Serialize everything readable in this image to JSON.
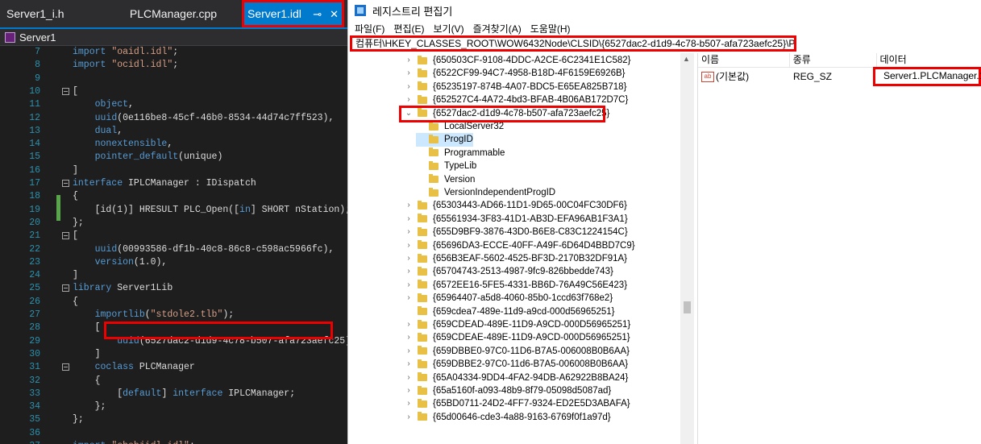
{
  "editor": {
    "tabs": [
      {
        "label": "Server1_i.h"
      },
      {
        "label": "PLCManager.cpp"
      },
      {
        "label": "Server1.idl",
        "pin": "⊸",
        "close": "✕"
      }
    ],
    "object_label": "Server1",
    "lines": [
      {
        "n": "7",
        "text": "import \"oaidl.idl\";"
      },
      {
        "n": "8",
        "text": "import \"ocidl.idl\";"
      },
      {
        "n": "9",
        "text": ""
      },
      {
        "n": "10",
        "text": "["
      },
      {
        "n": "11",
        "text": "    object,"
      },
      {
        "n": "12",
        "text": "    uuid(0e116be8-45cf-46b0-8534-44d74c7ff523),"
      },
      {
        "n": "13",
        "text": "    dual,"
      },
      {
        "n": "14",
        "text": "    nonextensible,"
      },
      {
        "n": "15",
        "text": "    pointer_default(unique)"
      },
      {
        "n": "16",
        "text": "]"
      },
      {
        "n": "17",
        "text": "interface IPLCManager : IDispatch"
      },
      {
        "n": "18",
        "text": "{"
      },
      {
        "n": "19",
        "text": "    [id(1)] HRESULT PLC_Open([in] SHORT nStation);"
      },
      {
        "n": "20",
        "text": "};"
      },
      {
        "n": "21",
        "text": "["
      },
      {
        "n": "22",
        "text": "    uuid(00993586-df1b-40c8-86c8-c598ac5966fc),"
      },
      {
        "n": "23",
        "text": "    version(1.0),"
      },
      {
        "n": "24",
        "text": "]"
      },
      {
        "n": "25",
        "text": "library Server1Lib"
      },
      {
        "n": "26",
        "text": "{"
      },
      {
        "n": "27",
        "text": "    importlib(\"stdole2.tlb\");"
      },
      {
        "n": "28",
        "text": "    ["
      },
      {
        "n": "29",
        "text": "        uuid(6527dac2-d1d9-4c78-b507-afa723aefc25)"
      },
      {
        "n": "30",
        "text": "    ]"
      },
      {
        "n": "31",
        "text": "    coclass PLCManager"
      },
      {
        "n": "32",
        "text": "    {"
      },
      {
        "n": "33",
        "text": "        [default] interface IPLCManager;"
      },
      {
        "n": "34",
        "text": "    };"
      },
      {
        "n": "35",
        "text": "};"
      },
      {
        "n": "36",
        "text": ""
      },
      {
        "n": "37",
        "text": "import \"shobjidl.idl\";"
      }
    ]
  },
  "regedit": {
    "title": "레지스트리 편집기",
    "menu": [
      "파일(F)",
      "편집(E)",
      "보기(V)",
      "즐겨찾기(A)",
      "도움말(H)"
    ],
    "address": "컴퓨터\\HKEY_CLASSES_ROOT\\WOW6432Node\\CLSID\\{6527dac2-d1d9-4c78-b507-afa723aefc25}\\ProgID",
    "tree": [
      {
        "label": "{650503CF-9108-4DDC-A2CE-6C2341E1C582}",
        "level": 0,
        "exp": "›"
      },
      {
        "label": "{6522CF99-94C7-4958-B18D-4F6159E6926B}",
        "level": 0,
        "exp": "›"
      },
      {
        "label": "{65235197-874B-4A07-BDC5-E65EA825B718}",
        "level": 0,
        "exp": "›"
      },
      {
        "label": "{652527C4-4A72-4bd3-BFAB-4B06AB172D7C}",
        "level": 0,
        "exp": "›"
      },
      {
        "label": "{6527dac2-d1d9-4c78-b507-afa723aefc25}",
        "level": 0,
        "exp": "⌄"
      },
      {
        "label": "LocalServer32",
        "level": 1,
        "exp": ""
      },
      {
        "label": "ProgID",
        "level": 1,
        "exp": ""
      },
      {
        "label": "Programmable",
        "level": 1,
        "exp": ""
      },
      {
        "label": "TypeLib",
        "level": 1,
        "exp": ""
      },
      {
        "label": "Version",
        "level": 1,
        "exp": ""
      },
      {
        "label": "VersionIndependentProgID",
        "level": 1,
        "exp": ""
      },
      {
        "label": "{65303443-AD66-11D1-9D65-00C04FC30DF6}",
        "level": 0,
        "exp": "›"
      },
      {
        "label": "{65561934-3F83-41D1-AB3D-EFA96AB1F3A1}",
        "level": 0,
        "exp": "›"
      },
      {
        "label": "{655D9BF9-3876-43D0-B6E8-C83C1224154C}",
        "level": 0,
        "exp": "›"
      },
      {
        "label": "{65696DA3-ECCE-40FF-A49F-6D64D4BBD7C9}",
        "level": 0,
        "exp": "›"
      },
      {
        "label": "{656B3EAF-5602-4525-BF3D-2170B32DF91A}",
        "level": 0,
        "exp": "›"
      },
      {
        "label": "{65704743-2513-4987-9fc9-826bbedde743}",
        "level": 0,
        "exp": "›"
      },
      {
        "label": "{6572EE16-5FE5-4331-BB6D-76A49C56E423}",
        "level": 0,
        "exp": "›"
      },
      {
        "label": "{65964407-a5d8-4060-85b0-1ccd63f768e2}",
        "level": 0,
        "exp": "›"
      },
      {
        "label": "{659cdea7-489e-11d9-a9cd-000d56965251}",
        "level": 0,
        "exp": ""
      },
      {
        "label": "{659CDEAD-489E-11D9-A9CD-000D56965251}",
        "level": 0,
        "exp": "›"
      },
      {
        "label": "{659CDEAE-489E-11D9-A9CD-000D56965251}",
        "level": 0,
        "exp": "›"
      },
      {
        "label": "{659DBBE0-97C0-11D6-B7A5-006008B0B6AA}",
        "level": 0,
        "exp": "›"
      },
      {
        "label": "{659DBBE2-97C0-11d6-B7A5-006008B0B6AA}",
        "level": 0,
        "exp": "›"
      },
      {
        "label": "{65A04334-9DD4-4FA2-94DB-A62922B8BA24}",
        "level": 0,
        "exp": "›"
      },
      {
        "label": "{65a5160f-a093-48b9-8f79-05098d5087ad}",
        "level": 0,
        "exp": "›"
      },
      {
        "label": "{65BD0711-24D2-4FF7-9324-ED2E5D3ABAFA}",
        "level": 0,
        "exp": "›"
      },
      {
        "label": "{65d00646-cde3-4a88-9163-6769f0f1a97d}",
        "level": 0,
        "exp": "›"
      }
    ],
    "columns": {
      "name": "이름",
      "type": "종류",
      "data": "데이터"
    },
    "value": {
      "name": "(기본값)",
      "type": "REG_SZ",
      "data": "Server1.PLCManager.1",
      "icon": "ab"
    }
  }
}
